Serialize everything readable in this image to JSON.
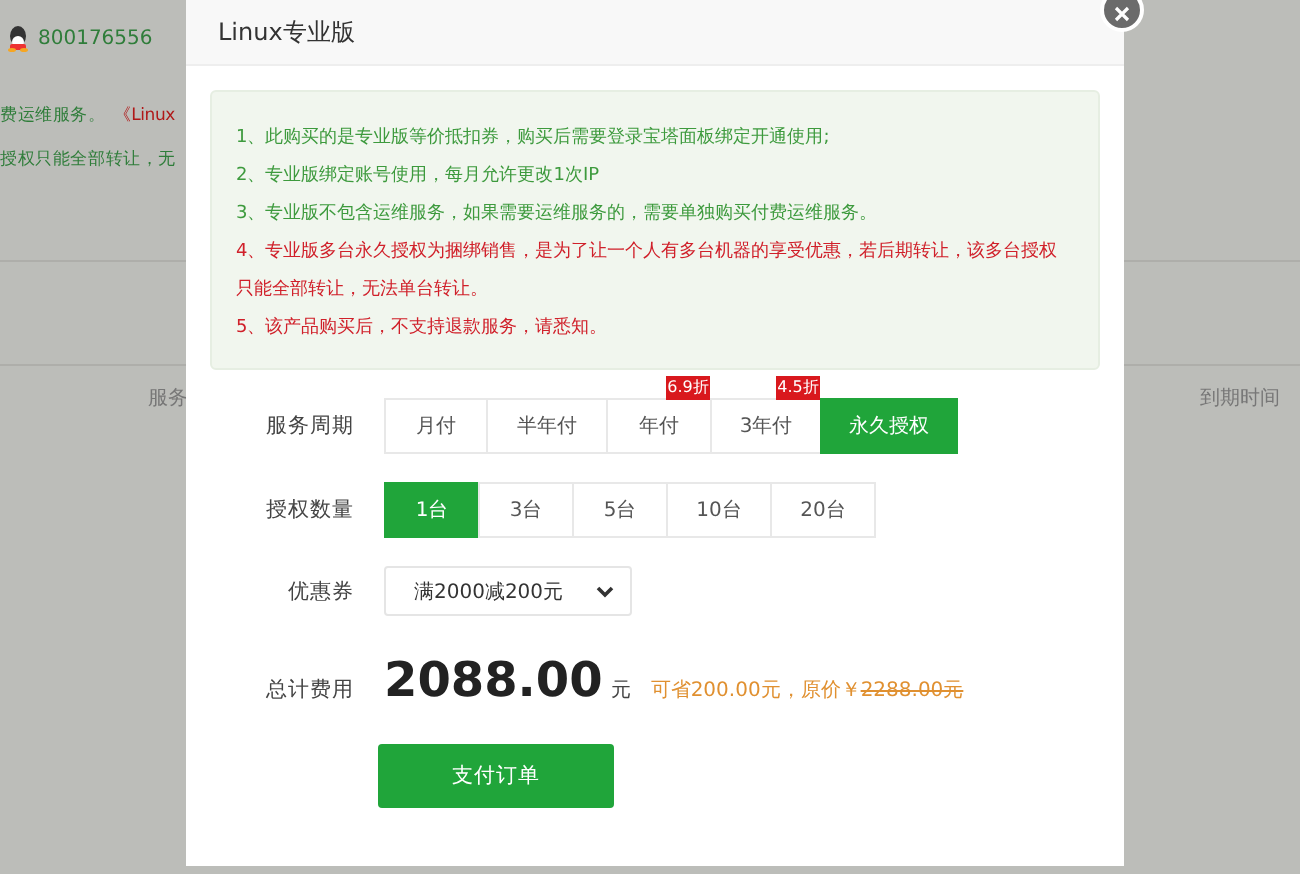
{
  "background": {
    "qq_number": "800176556",
    "left_lines": [
      "费运维服务。",
      "授权只能全部转让，无"
    ],
    "left_link": "《Linux",
    "left_column": "服务",
    "right_column": "到期时间"
  },
  "dialog": {
    "title": "Linux专业版",
    "notices": [
      {
        "text": "1、此购买的是专业版等价抵扣券，购买后需要登录宝塔面板绑定开通使用;",
        "color": "#3d9a3d"
      },
      {
        "text": "2、专业版绑定账号使用，每月允许更改1次IP",
        "color": "#3d9a3d"
      },
      {
        "text": "3、专业版不包含运维服务，如果需要运维服务的，需要单独购买付费运维服务。",
        "color": "#3d9a3d"
      },
      {
        "text": "4、专业版多台永久授权为捆绑销售，是为了让一个人有多台机器的享受优惠，若后期转让，该多台授权只能全部转让，无法单台转让。",
        "color": "#d0202a"
      },
      {
        "text": "5、该产品购买后，不支持退款服务，请悉知。",
        "color": "#d0202a"
      }
    ],
    "period": {
      "label": "服务周期",
      "options": [
        {
          "label": "月付",
          "selected": false
        },
        {
          "label": "半年付",
          "selected": false
        },
        {
          "label": "年付",
          "badge": "6.9折",
          "selected": false
        },
        {
          "label": "3年付",
          "badge": "4.5折",
          "selected": false
        },
        {
          "label": "永久授权",
          "selected": true
        }
      ]
    },
    "quantity": {
      "label": "授权数量",
      "options": [
        {
          "label": "1台",
          "selected": true
        },
        {
          "label": "3台",
          "selected": false
        },
        {
          "label": "5台",
          "selected": false
        },
        {
          "label": "10台",
          "selected": false
        },
        {
          "label": "20台",
          "selected": false
        }
      ]
    },
    "coupon": {
      "label": "优惠券",
      "value": "满2000减200元"
    },
    "total": {
      "label": "总计费用",
      "amount": "2088.00",
      "unit": "元",
      "savings": "可省200.00元，原价￥",
      "original_price": "2288.00元"
    },
    "pay_button": "支付订单"
  }
}
